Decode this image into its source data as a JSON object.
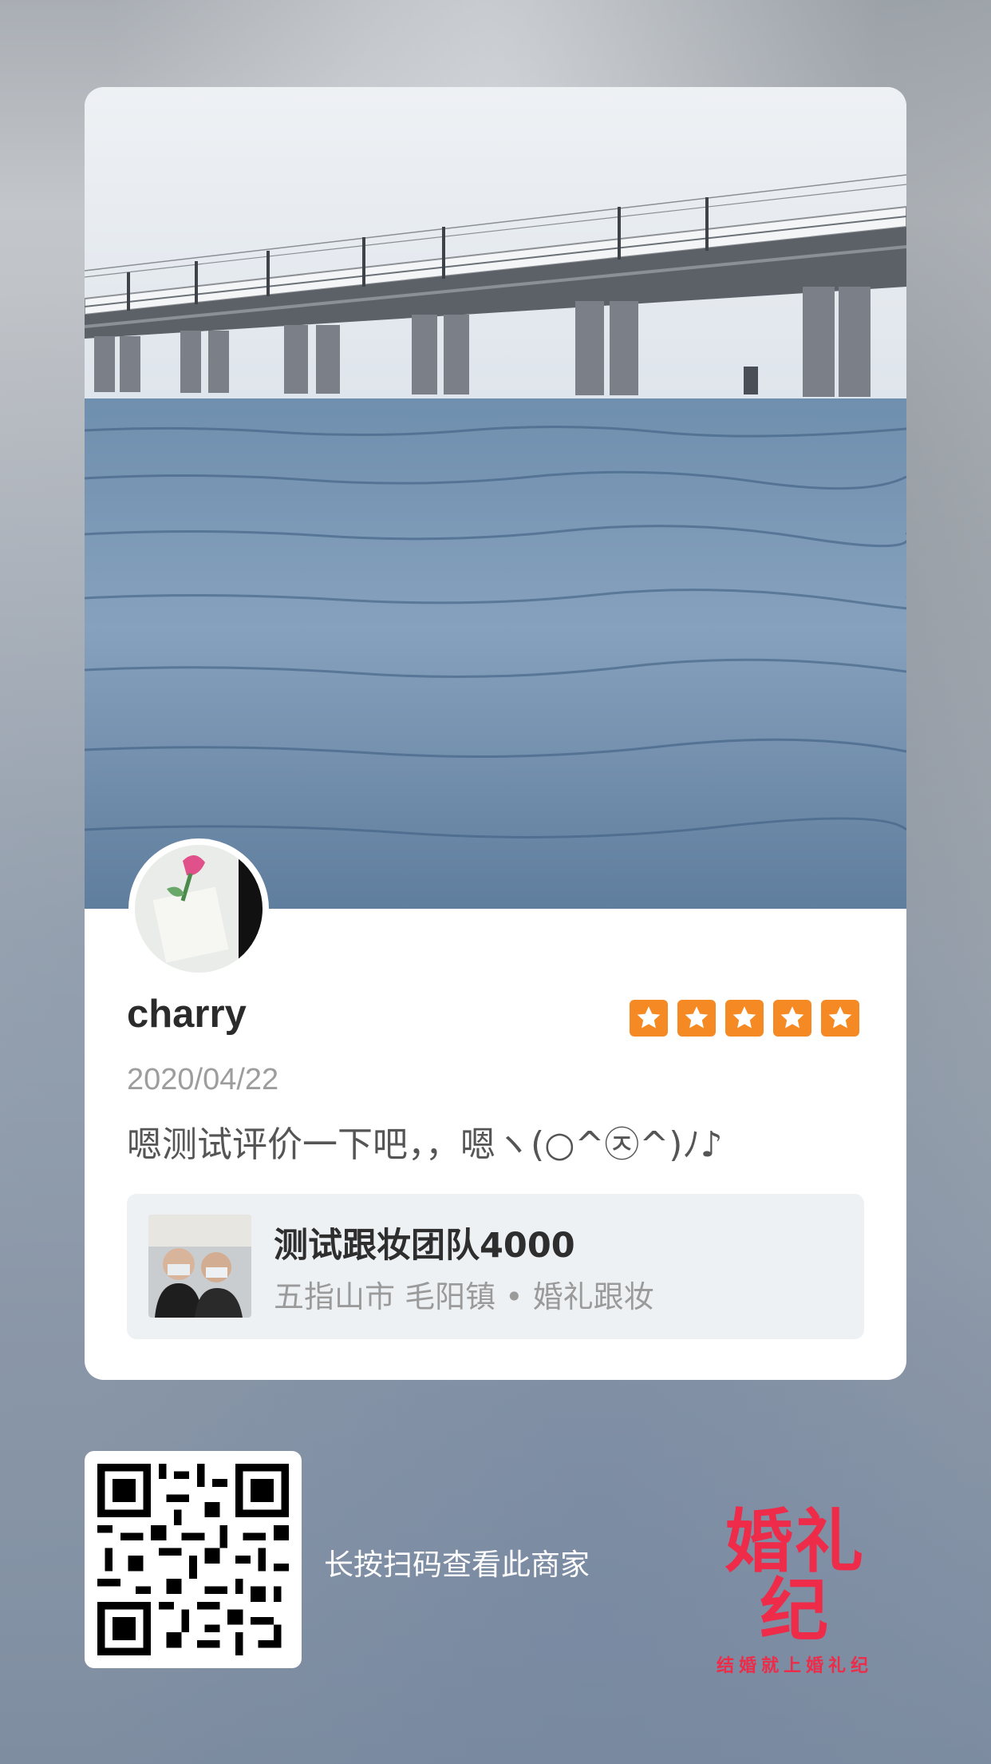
{
  "review": {
    "username": "charry",
    "rating": 5,
    "date": "2020/04/22",
    "text": "嗯测试评价一下吧，，嗯ヽ(○^㉨^)ﾉ♪"
  },
  "merchant": {
    "name": "测试跟妆团队4000",
    "meta": "五指山市 毛阳镇 • 婚礼跟妆"
  },
  "footer": {
    "scan_hint": "长按扫码查看此商家",
    "brand_logo": "婚礼纪",
    "brand_slogan": "结婚就上婚礼纪"
  },
  "icons": {
    "star": "star-icon",
    "qr": "qr-code",
    "avatar": "user-avatar"
  },
  "colors": {
    "star": "#f58a24",
    "brand": "#ee2b49"
  }
}
